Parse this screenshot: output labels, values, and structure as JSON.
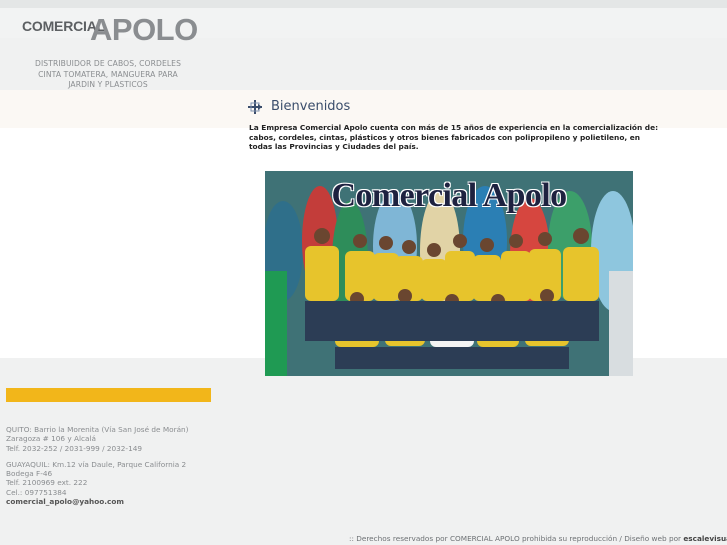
{
  "brand": {
    "logo_small": "COMERCIAL",
    "logo_big": "APOLO",
    "tagline": [
      "DISTRIBUIDOR DE CABOS, CORDELES",
      "CINTA TOMATERA, MANGUERA PARA",
      "JARDIN Y PLASTICOS"
    ]
  },
  "main": {
    "heading": "Bienvenidos",
    "intro": "La Empresa Comercial Apolo cuenta con más de 15 años de experiencia en la comercialización de: cabos, cordeles, cintas, plásticos y otros bienes fabricados con polipropileno y polietileno, en todas las Provincias y Ciudades del país.",
    "photo_caption": "Comercial Apolo"
  },
  "contact": {
    "quito": [
      "QUITO: Barrio la Morenita (Vía San José de Morán)",
      "Zaragoza # 106 y Alcalá",
      "Telf. 2032-252 / 2031-999 / 2032-149"
    ],
    "guayaquil": [
      "GUAYAQUIL: Km.12 vía Daule, Parque California 2",
      "Bodega F-46",
      "Telf. 2100969 ext. 222",
      "Cel.: 097751384"
    ],
    "email": "comercial_apolo@yahoo.com"
  },
  "footer": {
    "text": ":: Derechos reservados por COMERCIAL APOLO prohibida su reproducción / Diseño web por ",
    "link": "escalevisual"
  },
  "colors": {
    "accent_yellow": "#f2b61a",
    "heading_blue": "#3a4d6b",
    "logo_gray": "#8a8d90",
    "background": "#f0f1f1"
  },
  "icons": {
    "heading": "crosshair-arrows-icon"
  }
}
